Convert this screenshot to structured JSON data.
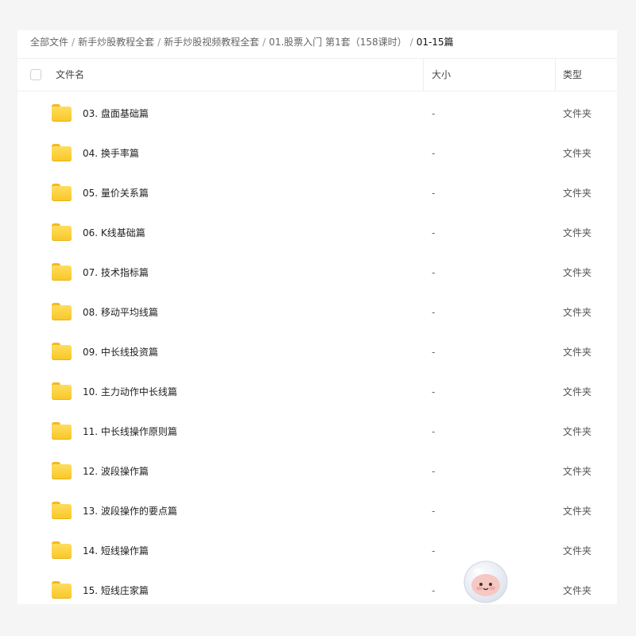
{
  "breadcrumb": [
    {
      "label": "全部文件",
      "current": false
    },
    {
      "label": "新手炒股教程全套",
      "current": false
    },
    {
      "label": "新手炒股视频教程全套",
      "current": false
    },
    {
      "label": "01.股票入门 第1套（158课时）",
      "current": false
    },
    {
      "label": "01-15篇",
      "current": true
    }
  ],
  "breadcrumb_separator": "/",
  "table": {
    "headers": {
      "name": "文件名",
      "size": "大小",
      "type": "类型"
    },
    "rows": [
      {
        "name": "03. 盘面基础篇",
        "size": "-",
        "type": "文件夹"
      },
      {
        "name": "04. 换手率篇",
        "size": "-",
        "type": "文件夹"
      },
      {
        "name": "05. 量价关系篇",
        "size": "-",
        "type": "文件夹"
      },
      {
        "name": "06. K线基础篇",
        "size": "-",
        "type": "文件夹"
      },
      {
        "name": "07. 技术指标篇",
        "size": "-",
        "type": "文件夹"
      },
      {
        "name": "08. 移动平均线篇",
        "size": "-",
        "type": "文件夹"
      },
      {
        "name": "09. 中长线投资篇",
        "size": "-",
        "type": "文件夹"
      },
      {
        "name": "10. 主力动作中长线篇",
        "size": "-",
        "type": "文件夹"
      },
      {
        "name": "11. 中长线操作原则篇",
        "size": "-",
        "type": "文件夹"
      },
      {
        "name": "12. 波段操作篇",
        "size": "-",
        "type": "文件夹"
      },
      {
        "name": "13. 波段操作的要点篇",
        "size": "-",
        "type": "文件夹"
      },
      {
        "name": "14. 短线操作篇",
        "size": "-",
        "type": "文件夹"
      },
      {
        "name": "15. 短线庄家篇",
        "size": "-",
        "type": "文件夹"
      }
    ]
  },
  "icons": {
    "row_icon": "folder-icon",
    "assistant": "astronaut-mascot-icon"
  },
  "colors": {
    "folder": "#f9c726",
    "background": "#f5f5f6",
    "panel": "#ffffff"
  }
}
